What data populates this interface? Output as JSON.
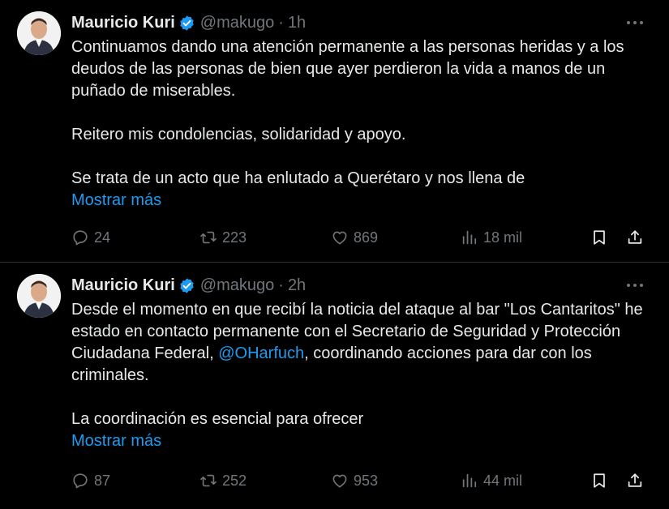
{
  "tweets": [
    {
      "author": "Mauricio Kuri",
      "handle": "@makugo",
      "separator": "·",
      "time": "1h",
      "paragraphs": [
        "Continuamos dando una atención permanente a las personas heridas y a los deudos de las personas de bien que ayer perdieron la vida a manos de un puñado de miserables.",
        "Reitero mis condolencias, solidaridad y apoyo.",
        "Se trata de un acto que ha enlutado a Querétaro y nos llena de"
      ],
      "show_more": "Mostrar más",
      "replies": "24",
      "retweets": "223",
      "likes": "869",
      "views": "18 mil"
    },
    {
      "author": "Mauricio Kuri",
      "handle": "@makugo",
      "separator": "·",
      "time": "2h",
      "paragraph1_before": "Desde el momento en que recibí la noticia del ataque al bar \"Los Cantaritos\" he estado en contacto permanente con el Secretario de Seguridad y Protección Ciudadana Federal, ",
      "mention": "@OHarfuch",
      "paragraph1_after": ", coordinando acciones para dar con los criminales.",
      "paragraph2": "La coordinación es esencial para ofrecer",
      "show_more": "Mostrar más",
      "replies": "87",
      "retweets": "252",
      "likes": "953",
      "views": "44 mil"
    }
  ],
  "colors": {
    "background": "#000000",
    "text": "#e7e9ea",
    "muted": "#71767b",
    "accent": "#1d9bf0",
    "divider": "#2f3336"
  },
  "icons": [
    "verified-badge-icon",
    "more-icon",
    "reply-icon",
    "retweet-icon",
    "like-icon",
    "views-icon",
    "bookmark-icon",
    "share-icon"
  ]
}
